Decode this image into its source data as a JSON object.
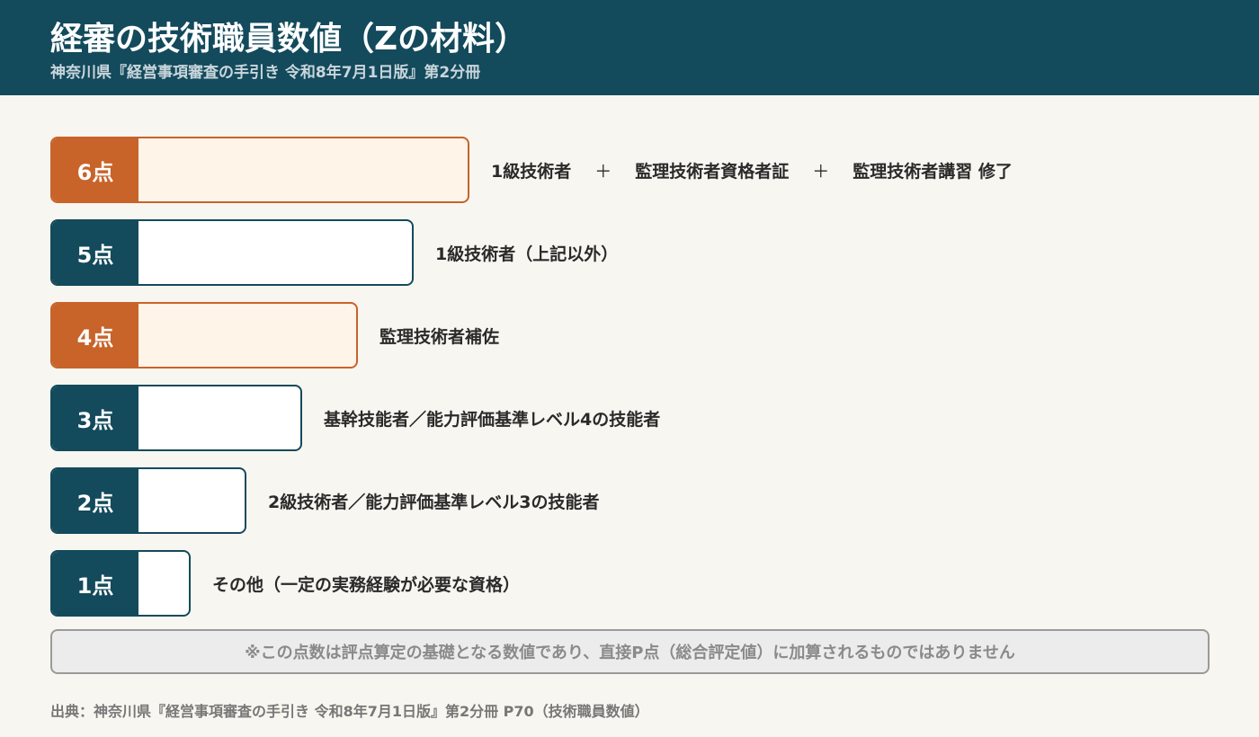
{
  "header": {
    "title": "経審の技術職員数値（Zの材料）",
    "subtitle": "神奈川県『経営事項審査の手引き 令和8年7月1日版』第2分冊"
  },
  "chart_data": {
    "type": "bar",
    "orientation": "horizontal",
    "categories": [
      "6点",
      "5点",
      "4点",
      "3点",
      "2点",
      "1点"
    ],
    "values": [
      6,
      5,
      4,
      3,
      2,
      1
    ],
    "descriptions": [
      [
        "1級技術者",
        "監理技術者資格者証",
        "監理技術者講習 修了"
      ],
      [
        "1級技術者（上記以外）"
      ],
      [
        "監理技術者補佐"
      ],
      [
        "基幹技能者／能力評価基準レベル4の技能者"
      ],
      [
        "2級技術者／能力評価基準レベル3の技能者"
      ],
      [
        "その他（一定の実務経験が必要な資格）"
      ]
    ],
    "highlighted": [
      true,
      false,
      true,
      false,
      false,
      false
    ],
    "separator": "＋",
    "colors": {
      "dark": "#134a5c",
      "accent": "#c8632a",
      "accent_fill": "#fef4e8"
    }
  },
  "note": "※この点数は評点算定の基礎となる数値であり、直接P点（総合評定値）に加算されるものではありません",
  "source": "出典：神奈川県『経営事項審査の手引き 令和8年7月1日版』第2分冊 P70（技術職員数値）"
}
